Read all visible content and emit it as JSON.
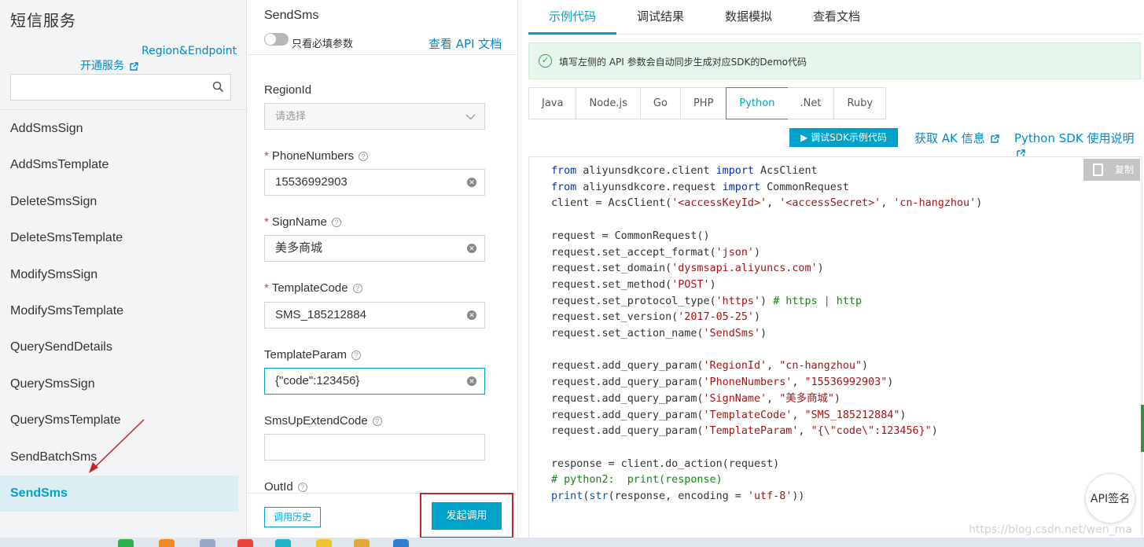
{
  "sidebar": {
    "title": "短信服务",
    "region_link": "Region&Endpoint",
    "open_service": "开通服务",
    "search": {
      "value": "",
      "placeholder": ""
    },
    "items": [
      {
        "label": "AddSmsSign"
      },
      {
        "label": "AddSmsTemplate"
      },
      {
        "label": "DeleteSmsSign"
      },
      {
        "label": "DeleteSmsTemplate"
      },
      {
        "label": "ModifySmsSign"
      },
      {
        "label": "ModifySmsTemplate"
      },
      {
        "label": "QuerySendDetails"
      },
      {
        "label": "QuerySmsSign"
      },
      {
        "label": "QuerySmsTemplate"
      },
      {
        "label": "SendBatchSms"
      },
      {
        "label": "SendSms",
        "active": true
      }
    ]
  },
  "form": {
    "title": "SendSms",
    "toggle_label": "只看必填参数",
    "toggle_on": false,
    "api_doc_link": "查看 API 文档",
    "fields": {
      "region": {
        "label": "RegionId",
        "placeholder": "请选择"
      },
      "phone": {
        "label": "PhoneNumbers",
        "value": "15536992903",
        "required": true
      },
      "sign": {
        "label": "SignName",
        "value": "美多商城",
        "required": true
      },
      "template_code": {
        "label": "TemplateCode",
        "value": "SMS_185212884",
        "required": true
      },
      "template_param": {
        "label": "TemplateParam",
        "value": "{\"code\":123456}"
      },
      "extend_code": {
        "label": "SmsUpExtendCode",
        "value": ""
      },
      "out_id": {
        "label": "OutId"
      }
    },
    "history_button": "调用历史",
    "call_button": "发起调用"
  },
  "right": {
    "tabs": [
      {
        "label": "示例代码",
        "active": true
      },
      {
        "label": "调试结果"
      },
      {
        "label": "数据模拟"
      },
      {
        "label": "查看文档"
      }
    ],
    "notice": "填写左侧的 API 参数会自动同步生成对应SDK的Demo代码",
    "languages": [
      "Java",
      "Node.js",
      "Go",
      "PHP",
      "Python",
      ".Net",
      "Ruby"
    ],
    "active_language": "Python",
    "debug_sdk_button": "调试SDK示例代码",
    "ak_link": "获取 AK 信息",
    "sdk_link": "Python SDK 使用说明",
    "copy_button": "复制",
    "api_sign_button": "API签名",
    "watermark": "https://blog.csdn.net/wen_ma"
  },
  "colors": {
    "accent": "#00a2ca",
    "link": "#0088cc",
    "active_item_bg": "#dceef3",
    "annotation_red": "#c0272d",
    "notice_bg": "#e7f6ec"
  }
}
